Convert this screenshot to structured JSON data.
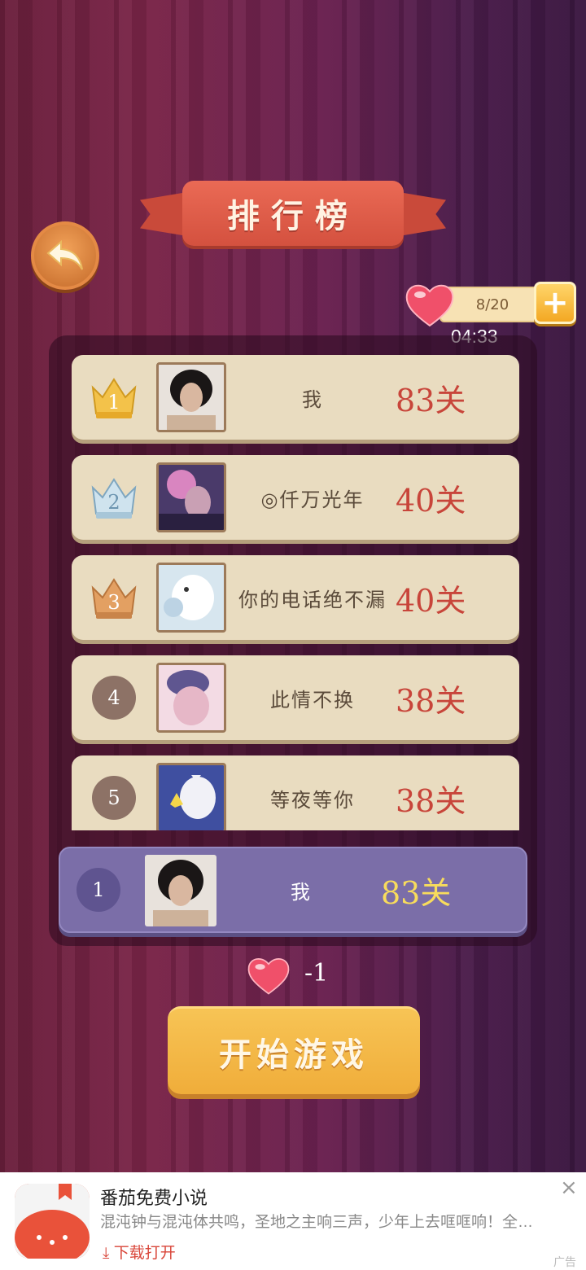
{
  "title": "排行榜",
  "lives": {
    "text": "8/20",
    "plus": "+"
  },
  "timer": "04:33",
  "ranking": [
    {
      "rank": "1",
      "name": "我",
      "score": "83关",
      "badge": "gold-crown"
    },
    {
      "rank": "2",
      "name": "◎仟万光年",
      "score": "40关",
      "badge": "silver-crown"
    },
    {
      "rank": "3",
      "name": "你的电话绝不漏",
      "score": "40关",
      "badge": "bronze-crown"
    },
    {
      "rank": "4",
      "name": "此情不换",
      "score": "38关",
      "badge": "circle"
    },
    {
      "rank": "5",
      "name": "等夜等你",
      "score": "38关",
      "badge": "circle"
    }
  ],
  "me": {
    "rank": "1",
    "name": "我",
    "score": "83关"
  },
  "cost": "-1",
  "start_label": "开始游戏",
  "ad": {
    "title": "番茄免费小说",
    "desc": "混沌钟与混沌体共鸣，圣地之主响三声，少年上去哐哐响！全…",
    "cta": "下载打开",
    "close": "×",
    "tag": "广告"
  },
  "colors": {
    "accent": "#f0ad3a",
    "score": "#c8453a",
    "me_row": "#7b6ea8"
  }
}
